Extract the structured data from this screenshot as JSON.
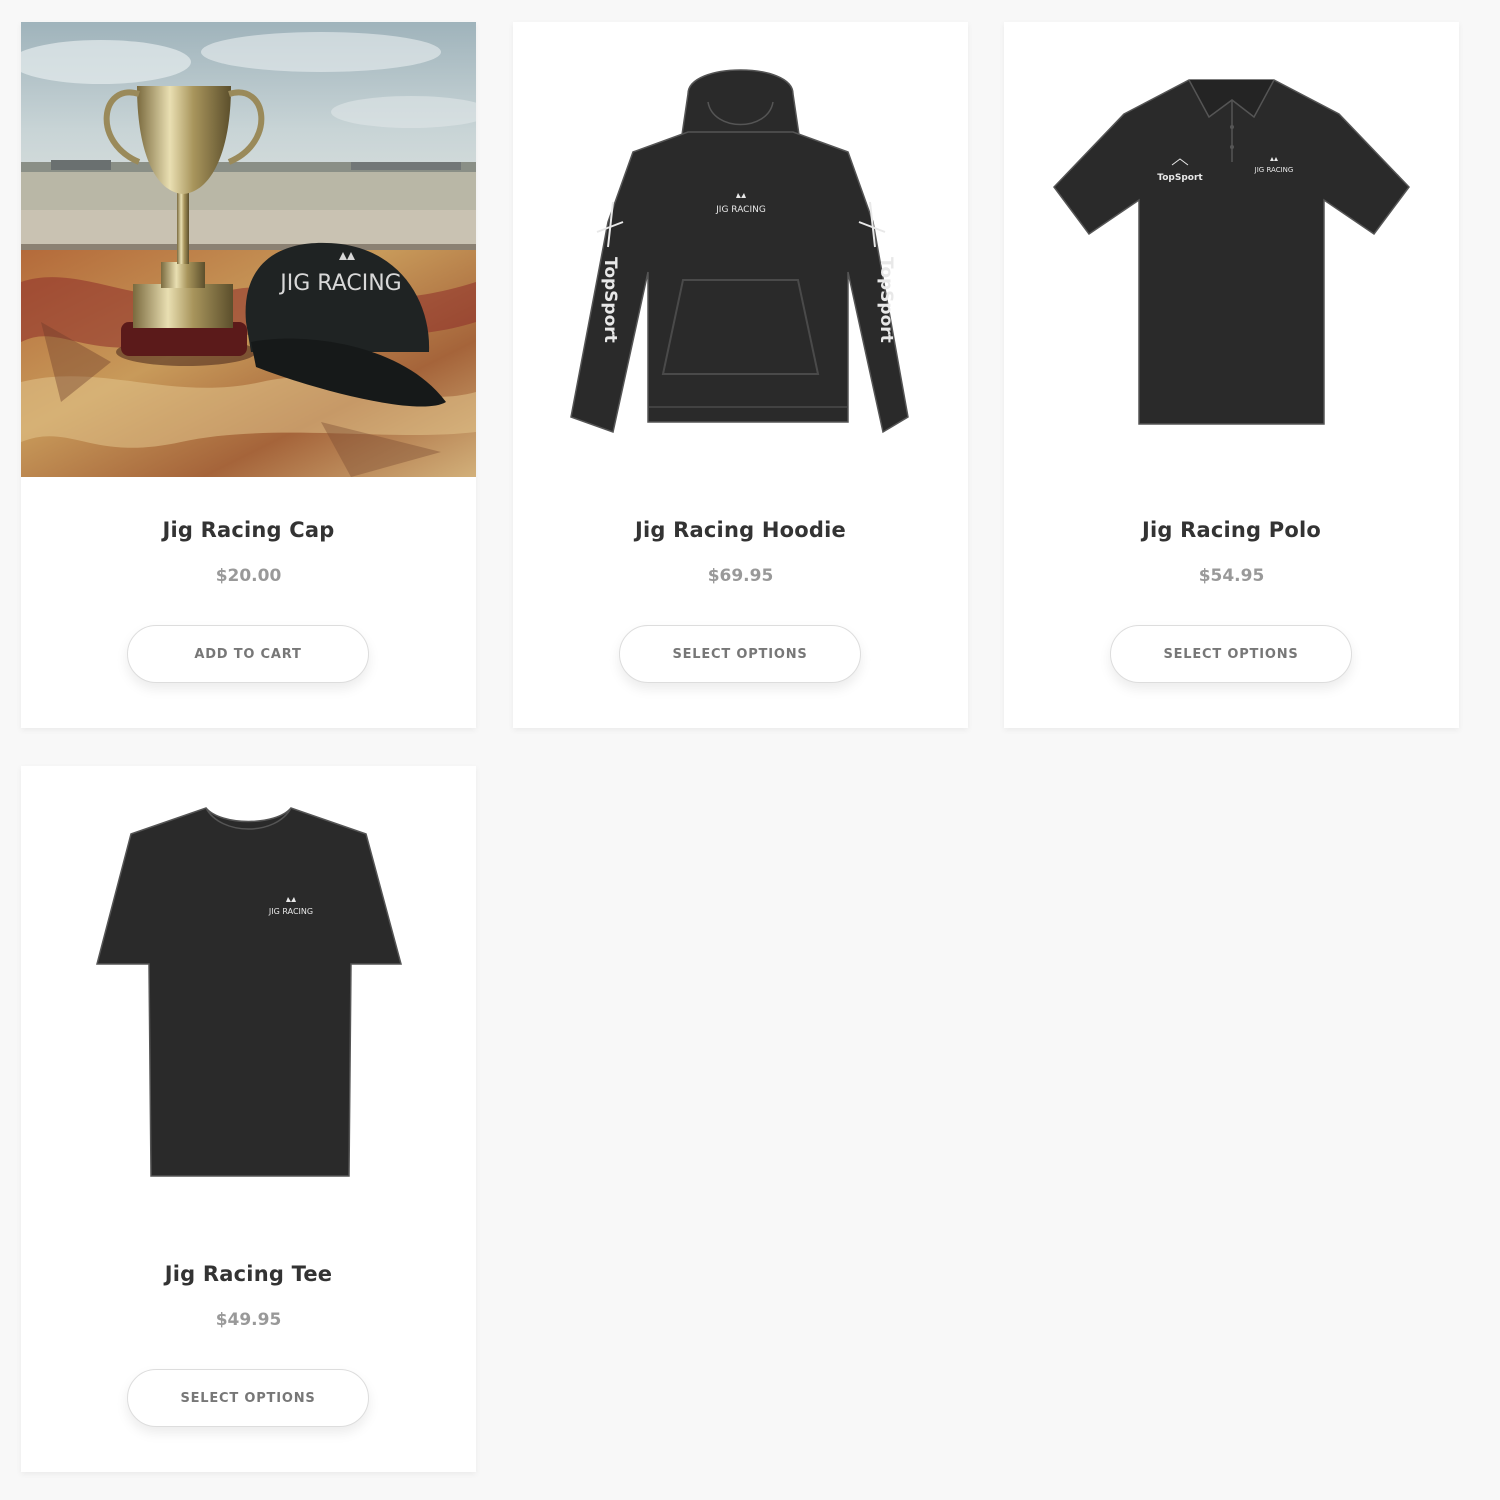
{
  "products": [
    {
      "title": "Jig Racing Cap",
      "price": "$20.00",
      "button_label": "ADD TO CART",
      "image": {
        "type": "photo",
        "description_icon": "trophy-and-cap-photo",
        "cap_text": "JIG RACING"
      }
    },
    {
      "title": "Jig Racing Hoodie",
      "price": "$69.95",
      "button_label": "SELECT OPTIONS",
      "image": {
        "type": "garment",
        "garment_icon": "hoodie-icon",
        "chest_text": "JIG RACING",
        "sleeve_text": "TopSport"
      }
    },
    {
      "title": "Jig Racing Polo",
      "price": "$54.95",
      "button_label": "SELECT OPTIONS",
      "image": {
        "type": "garment",
        "garment_icon": "polo-icon",
        "left_chest_text": "TopSport",
        "right_chest_text": "JIG RACING"
      }
    },
    {
      "title": "Jig Racing Tee",
      "price": "$49.95",
      "button_label": "SELECT OPTIONS",
      "image": {
        "type": "garment",
        "garment_icon": "tshirt-icon",
        "chest_text": "JIG RACING"
      }
    }
  ],
  "colors": {
    "page_background": "#f8f8f8",
    "card_background": "#ffffff",
    "title_text": "#333333",
    "price_text": "#999999",
    "button_text": "#777777",
    "garment": "#2a2a2a",
    "garment_print": "#e8e8e8"
  }
}
